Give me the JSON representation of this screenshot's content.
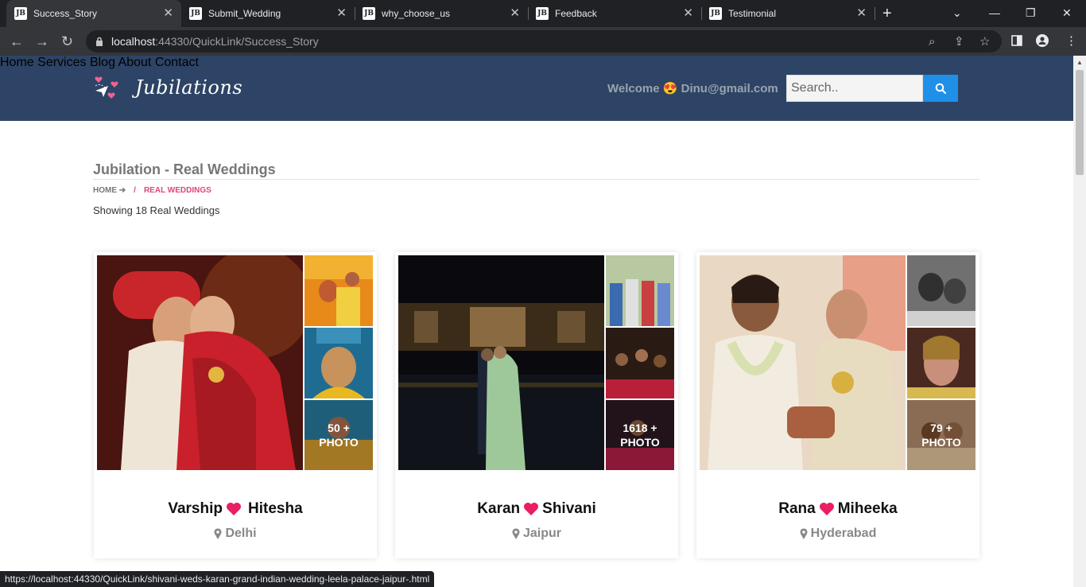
{
  "browser": {
    "tabs": [
      {
        "label": "Success_Story",
        "favicon": "JB"
      },
      {
        "label": "Submit_Wedding",
        "favicon": "JB"
      },
      {
        "label": "why_choose_us",
        "favicon": "JB"
      },
      {
        "label": "Feedback",
        "favicon": "JB"
      },
      {
        "label": "Testimonial",
        "favicon": "JB"
      }
    ],
    "url_host": "localhost",
    "url_rest": ":44330/QuickLink/Success_Story",
    "status_url": "https://localhost:44330/QuickLink/shivani-weds-karan-grand-indian-wedding-leela-palace-jaipur-.html"
  },
  "header": {
    "logo_text": "Jubilations",
    "nav": [
      "Home",
      "Services",
      "Blog",
      "About",
      "Contact"
    ],
    "welcome_prefix": "Welcome",
    "welcome_emoji": "😍",
    "user_email": "Dinu@gmail.com",
    "search_placeholder": "Search.."
  },
  "main": {
    "title": "Jubilation - Real Weddings",
    "breadcrumb_home": "HOME",
    "breadcrumb_sep": "/",
    "breadcrumb_current": "REAL WEDDINGS",
    "showing_text": "Showing 18 Real Weddings",
    "cards": [
      {
        "name1": "Varship",
        "name2": "Hitesha",
        "city": "Delhi",
        "photo_count_line1": "50 +",
        "photo_count_line2": "PHOTO"
      },
      {
        "name1": "Karan",
        "name2": "Shivani",
        "city": "Jaipur",
        "photo_count_line1": "1618 +",
        "photo_count_line2": "PHOTO"
      },
      {
        "name1": "Rana",
        "name2": "Miheeka",
        "city": "Hyderabad",
        "photo_count_line1": "79 +",
        "photo_count_line2": "PHOTO"
      }
    ]
  },
  "colors": {
    "header_bg": "#2d4466",
    "accent_pink": "#e91e63",
    "search_btn": "#1e90e8"
  }
}
